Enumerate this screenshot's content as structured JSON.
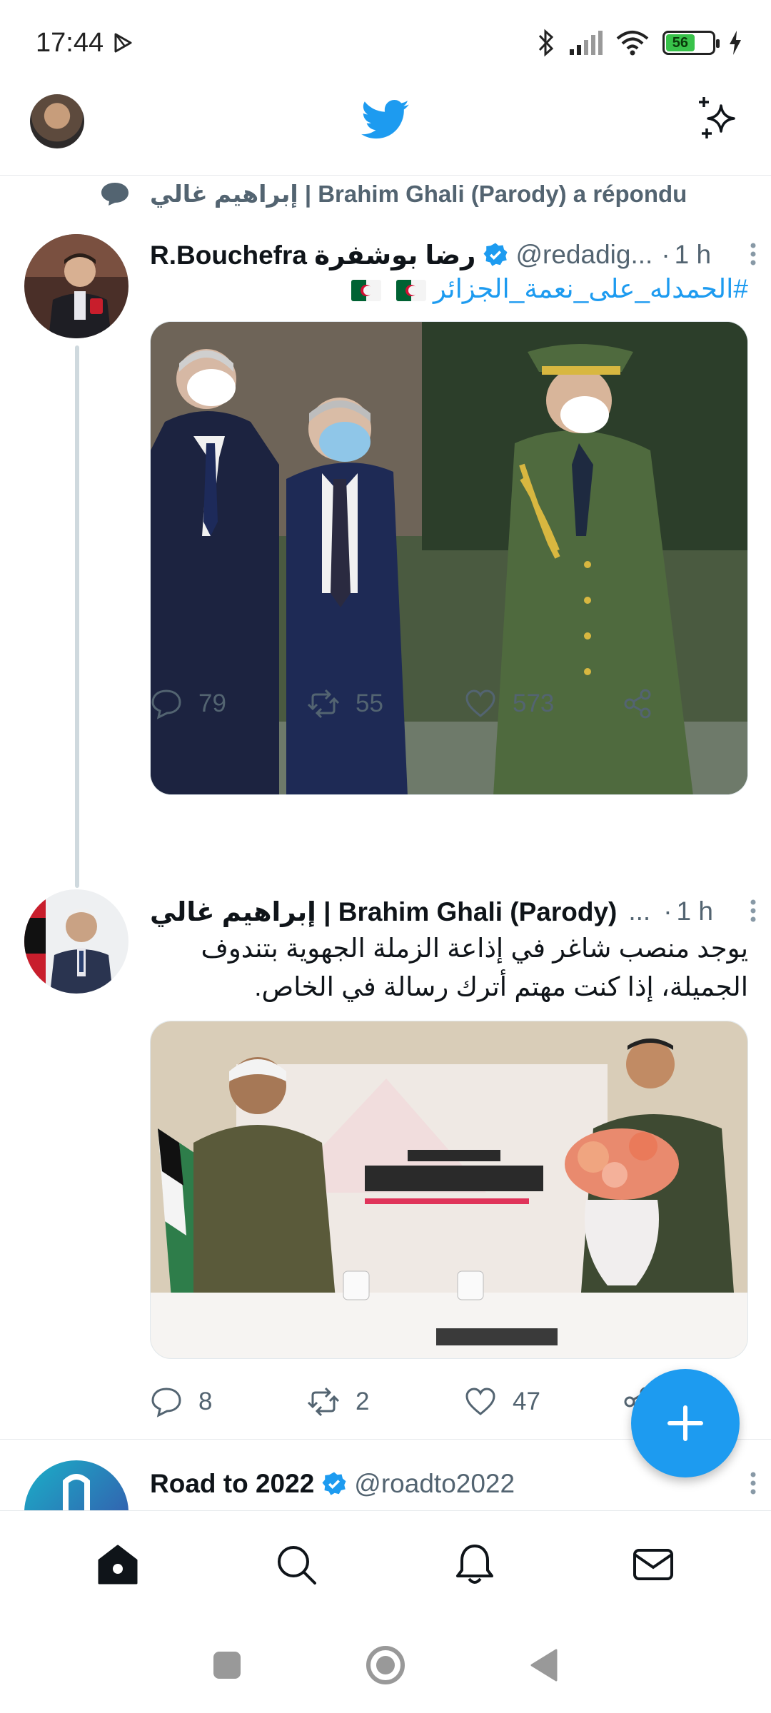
{
  "status_bar": {
    "time": "17:44",
    "battery_level": "56",
    "icons": [
      "play-store-icon",
      "bluetooth-icon",
      "signal-icon",
      "wifi-icon",
      "battery-icon",
      "charging-icon"
    ]
  },
  "header": {
    "logo": "twitter-bird-icon",
    "right_icon": "sparkle-icon"
  },
  "feed": {
    "reply_context": "إبراهيم غالي | Brahim Ghali (Parody) a répondu",
    "tweets": [
      {
        "name": "R.Bouchefra رضا بوشفرة",
        "verified": true,
        "handle": "@redadig...",
        "time": "1 h",
        "text": "#الحمدله_على_نعمة_الجزائر",
        "replies": "79",
        "retweets": "55",
        "likes": "573"
      },
      {
        "name": "إبراهيم غالي | Brahim Ghali (Parody)",
        "verified": false,
        "handle": "...",
        "time": "1 h",
        "text": "يوجد منصب شاغر في إذاعة الزملة الجهوية بتندوف الجميلة، إذا كنت مهتم أترك رسالة في الخاص.",
        "replies": "8",
        "retweets": "2",
        "likes": "47"
      },
      {
        "name": "Road to 2022",
        "verified": true,
        "handle": "@roadto2022",
        "time": "",
        "text": ""
      }
    ]
  },
  "colors": {
    "accent": "#1d9bf0",
    "muted": "#536471",
    "text": "#0f1419"
  }
}
